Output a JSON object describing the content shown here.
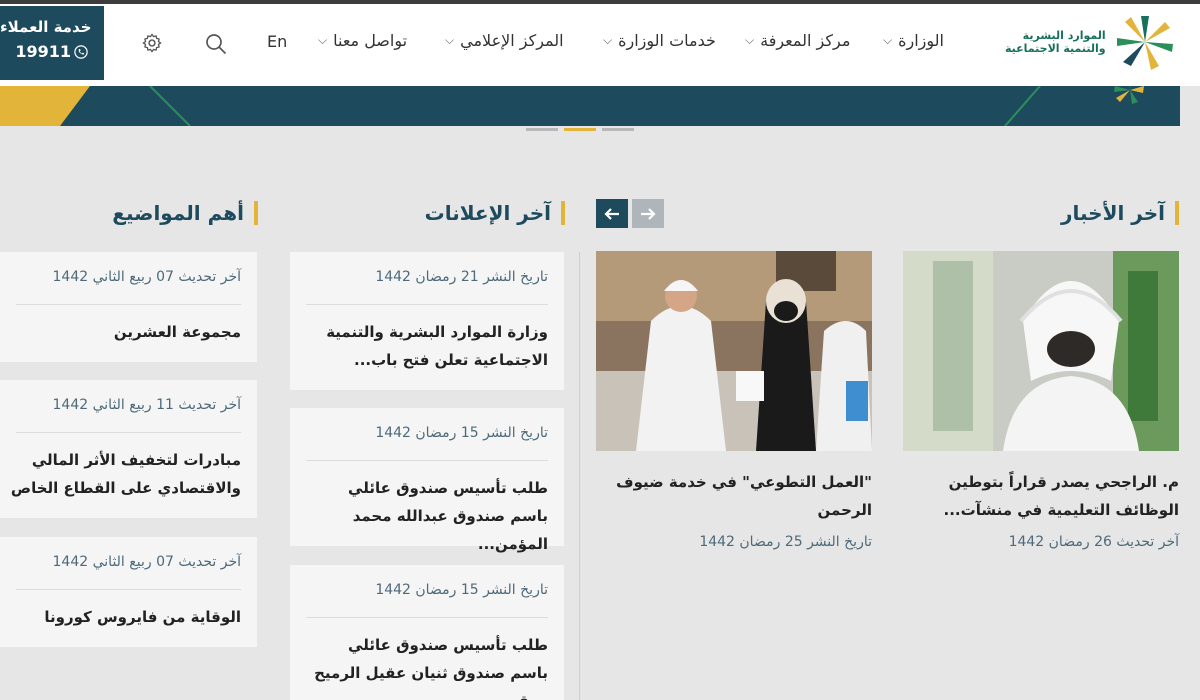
{
  "header": {
    "customer_service": {
      "title": "خدمة العملاء",
      "number": "19911"
    },
    "lang_label": "En",
    "nav": [
      {
        "label": "الوزارة"
      },
      {
        "label": "مركز المعرفة"
      },
      {
        "label": "خدمات الوزارة"
      },
      {
        "label": "المركز الإعلامي"
      },
      {
        "label": "تواصل معنا"
      }
    ],
    "logo": {
      "line1": "الموارد البشرية",
      "line2": "والتنمية الاجتماعية"
    }
  },
  "sections": {
    "news_title": "آخر الأخبار",
    "announcements_title": "آخر الإعلانات",
    "topics_title": "أهم المواضيع"
  },
  "news": [
    {
      "title": "م. الراجحي يصدر قراراً بتوطين الوظائف التعليمية في منشآت...",
      "date": "آخر تحديث 26 رمضان 1442"
    },
    {
      "title": "\"العمل التطوعي\" في خدمة ضيوف الرحمن",
      "date": "تاريخ النشر 25 رمضان 1442"
    }
  ],
  "announcements": [
    {
      "date": "تاريخ النشر 21 رمضان 1442",
      "title": "وزارة الموارد البشرية والتنمية الاجتماعية تعلن فتح باب..."
    },
    {
      "date": "تاريخ النشر 15 رمضان 1442",
      "title": "طلب تأسيس صندوق عائلي باسم صندوق عبدالله محمد المؤمن..."
    },
    {
      "date": "تاريخ النشر 15 رمضان 1442",
      "title": "طلب تأسيس صندوق عائلي باسم صندوق ثنيان عقيل الرميح ومقره..."
    }
  ],
  "topics": [
    {
      "date": "آخر تحديث 07 ربيع الثاني 1442",
      "title": "مجموعة العشرين"
    },
    {
      "date": "آخر تحديث 11 ربيع الثاني 1442",
      "title": "مبادرات لتخفيف الأثر المالي والاقتصادي على القطاع الخاص"
    },
    {
      "date": "آخر تحديث 07 ربيع الثاني 1442",
      "title": "الوقاية من فايروس كورونا"
    }
  ],
  "colors": {
    "brand": "#1e4a5e",
    "accent": "#e2b53a",
    "logo_green": "#17705c"
  }
}
